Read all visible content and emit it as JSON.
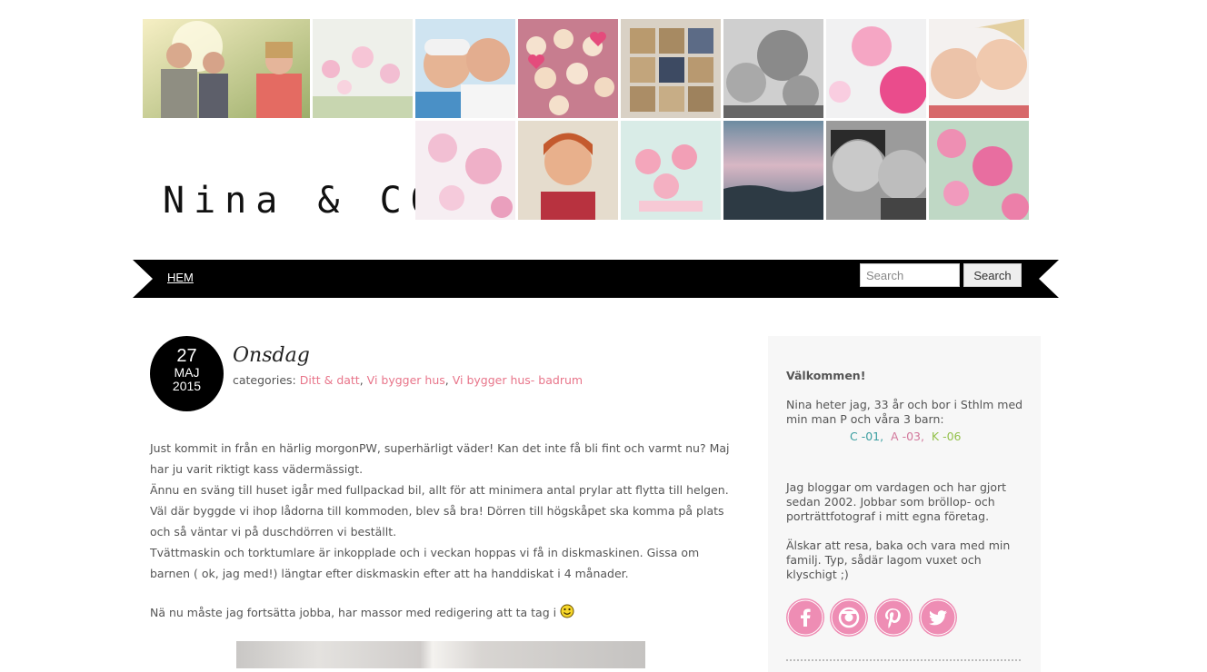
{
  "site": {
    "title": "Nina & CO"
  },
  "nav": {
    "home_label": "HEM"
  },
  "search": {
    "placeholder": "Search",
    "button_label": "Search"
  },
  "post": {
    "date": {
      "day": "27",
      "month": "MAJ",
      "year": "2015"
    },
    "title": "Onsdag",
    "categories_label": "categories:",
    "categories": [
      "Ditt & datt",
      "Vi bygger hus",
      "Vi bygger hus- badrum"
    ],
    "paragraphs": [
      "Just kommit in från en härlig morgonPW, superhärligt väder! Kan det inte få bli fint och varmt nu? Maj har ju varit riktigt kass vädermässigt.",
      "Ännu en sväng till huset igår med fullpackad bil, allt för att minimera antal prylar att flytta till helgen.",
      "Väl där byggde vi ihop lådorna till kommoden, blev så bra! Dörren till högskåpet ska komma på plats och så väntar vi på duschdörren vi beställt.",
      "Tvättmaskin och torktumlare är inkopplade och i veckan hoppas vi få in diskmaskinen. Gissa om barnen ( ok, jag med!)  längtar efter diskmaskin efter att ha handdiskat i 4 månader."
    ],
    "closing": "Nä nu måste jag fortsätta jobba, har massor med redigering att ta tag i"
  },
  "sidebar": {
    "welcome_title": "Välkommen!",
    "intro": "Nina heter jag, 33 år och bor i Sthlm med min man P och våra 3 barn:",
    "kids": [
      {
        "label": "C -01,",
        "color": "#3a9ea0"
      },
      {
        "label": "A -03,",
        "color": "#d2779b"
      },
      {
        "label": "K -06",
        "color": "#94c14c"
      }
    ],
    "about": "Jag bloggar om vardagen och har gjort sedan 2002. Jobbar som bröllop- och porträttfotograf i mitt egna företag.",
    "likes": "Älskar att resa, baka och vara med min familj. Typ, sådär lagom vuxet och klyschigt ;)",
    "social_icons": [
      "facebook-icon",
      "instagram-icon",
      "pinterest-icon",
      "twitter-icon"
    ]
  },
  "colors": {
    "accent_pink": "#e8758a",
    "social_pink": "#ee8db4",
    "nav_black": "#000000"
  }
}
